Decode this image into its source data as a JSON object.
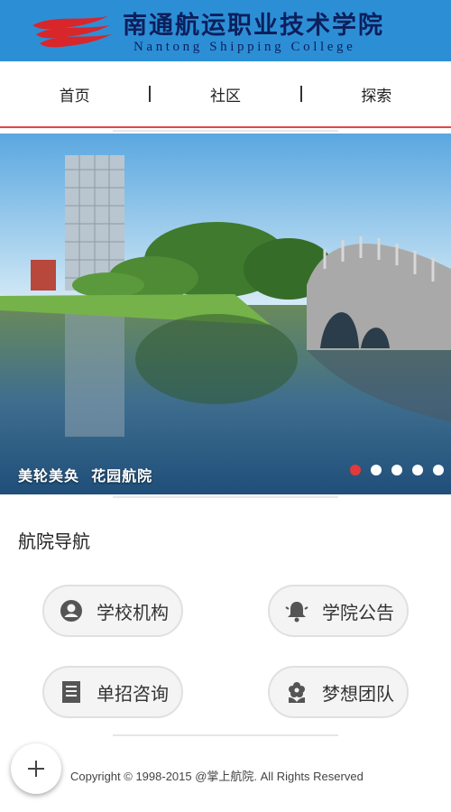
{
  "header": {
    "title_cn": "南通航运职业技术学院",
    "title_en": "Nantong Shipping College",
    "logo_icon": "waves-logo",
    "bg_color": "#2c8fd6"
  },
  "nav": {
    "items": [
      {
        "label": "首页"
      },
      {
        "label": "社区"
      },
      {
        "label": "探索"
      }
    ],
    "accent_color": "#e64545"
  },
  "carousel": {
    "caption": "美轮美奂  花园航院",
    "slide_count": 5,
    "active_index": 0
  },
  "section": {
    "title": "航院导航"
  },
  "buttons": [
    {
      "label": "学校机构",
      "icon": "person-circle-icon"
    },
    {
      "label": "学院公告",
      "icon": "bell-icon"
    },
    {
      "label": "单招咨询",
      "icon": "document-icon"
    },
    {
      "label": "梦想团队",
      "icon": "flower-icon"
    }
  ],
  "footer": {
    "copyright": "Copyright © 1998-2015 @掌上航院. All Rights Reserved",
    "fab_icon": "plus-icon"
  }
}
